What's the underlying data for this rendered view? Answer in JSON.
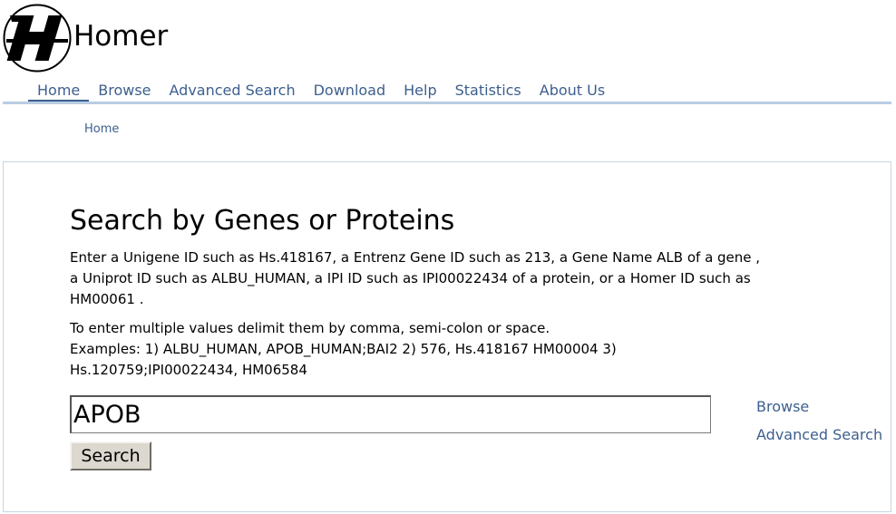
{
  "header": {
    "site_title": "Homer",
    "logo_letter": "H"
  },
  "nav": {
    "items": [
      {
        "label": "Home",
        "active": true
      },
      {
        "label": "Browse"
      },
      {
        "label": "Advanced Search"
      },
      {
        "label": "Download"
      },
      {
        "label": "Help"
      },
      {
        "label": "Statistics"
      },
      {
        "label": "About Us"
      }
    ]
  },
  "breadcrumb": {
    "home_label": "Home"
  },
  "main": {
    "heading": "Search by Genes or Proteins",
    "description": "Enter a Unigene ID such as Hs.418167, a Entrenz Gene ID such as 213, a Gene Name ALB of a gene , a Uniprot ID such as ALBU_HUMAN, a IPI ID such as IPI00022434 of a protein, or a Homer ID such as HM00061 .",
    "instructions": "To enter multiple values delimit them by comma, semi-colon or space.",
    "examples": "Examples: 1) ALBU_HUMAN, APOB_HUMAN;BAI2 2) 576, Hs.418167 HM00004 3) Hs.120759;IPI00022434, HM06584",
    "search_value": "APOB",
    "search_button_label": "Search"
  },
  "side_links": {
    "browse_label": "Browse",
    "advanced_search_label": "Advanced Search"
  },
  "colors": {
    "link": "#3d5f8e",
    "nav_rule": "#b9cde3",
    "panel_border": "#c6d6e2",
    "button_face": "#dcd8cf"
  },
  "icons": {
    "logo": "homer-h-logo"
  }
}
